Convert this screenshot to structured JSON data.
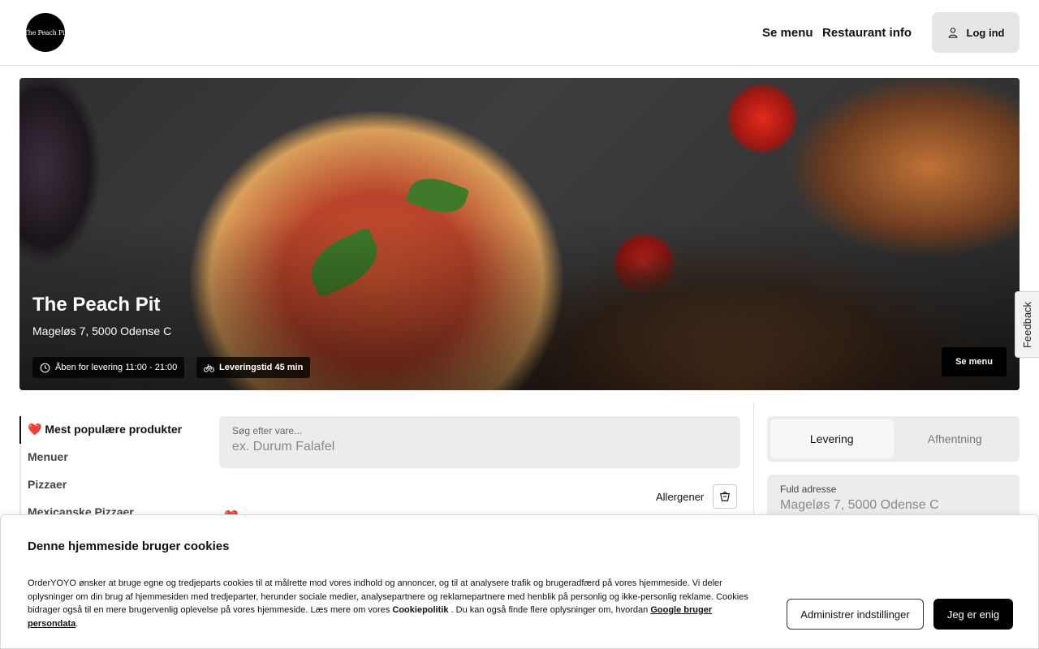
{
  "header": {
    "logo_text": "The Peach Pit",
    "nav": {
      "menu": "Se menu",
      "info": "Restaurant info"
    },
    "login_label": "Log ind",
    "login_icon": "user-icon"
  },
  "hero": {
    "title": "The Peach Pit",
    "address": "Mageløs 7, 5000 Odense C",
    "open_hours": "Åben for levering 11:00 - 21:00",
    "open_icon": "clock-icon",
    "delivery_time": "Leveringstid 45 min",
    "delivery_icon": "bicycle-icon",
    "menu_button": "Se menu"
  },
  "feedback_label": "Feedback",
  "categories": [
    {
      "label": "❤️ Mest populære produkter",
      "active": true
    },
    {
      "label": "Menuer",
      "active": false
    },
    {
      "label": "Pizzaer",
      "active": false
    },
    {
      "label": "Mexicanske Pizzaer",
      "active": false
    }
  ],
  "search": {
    "label": "Søg efter vare...",
    "placeholder": "ex. Durum Falafel"
  },
  "allergens": {
    "label": "Allergener",
    "icon": "allergen-filter-icon"
  },
  "order_mode": {
    "delivery": "Levering",
    "pickup": "Afhentning",
    "selected": "Levering"
  },
  "address_field": {
    "label": "Fuld adresse",
    "placeholder": "Mageløs 7, 5000 Odense C"
  },
  "cookie_banner": {
    "title": "Denne hjemmeside bruger cookies",
    "text_1": "OrderYOYO ønsker at bruge egne og tredjeparts cookies til at målrette mod vores indhold og annoncer, og til at analysere trafik og brugeradfærd på vores hjemmeside. Vi deler oplysninger om din brug af hjemmesiden med tredjeparter, herunder sociale medier, analysepartnere og reklamepartnere med henblik på personlig og ikke-personlig reklame. Cookies bidrager også til en mere brugervenlig oplevelse på vores hjemmeside. Læs mere om vores ",
    "cookie_policy_link": "Cookiepolitik",
    "text_2": " . Du kan også finde flere oplysninger om, hvordan ",
    "google_link": "Google bruger persondata",
    "text_3": ".",
    "manage_button": "Administrer indstillinger",
    "agree_button": "Jeg er enig"
  }
}
